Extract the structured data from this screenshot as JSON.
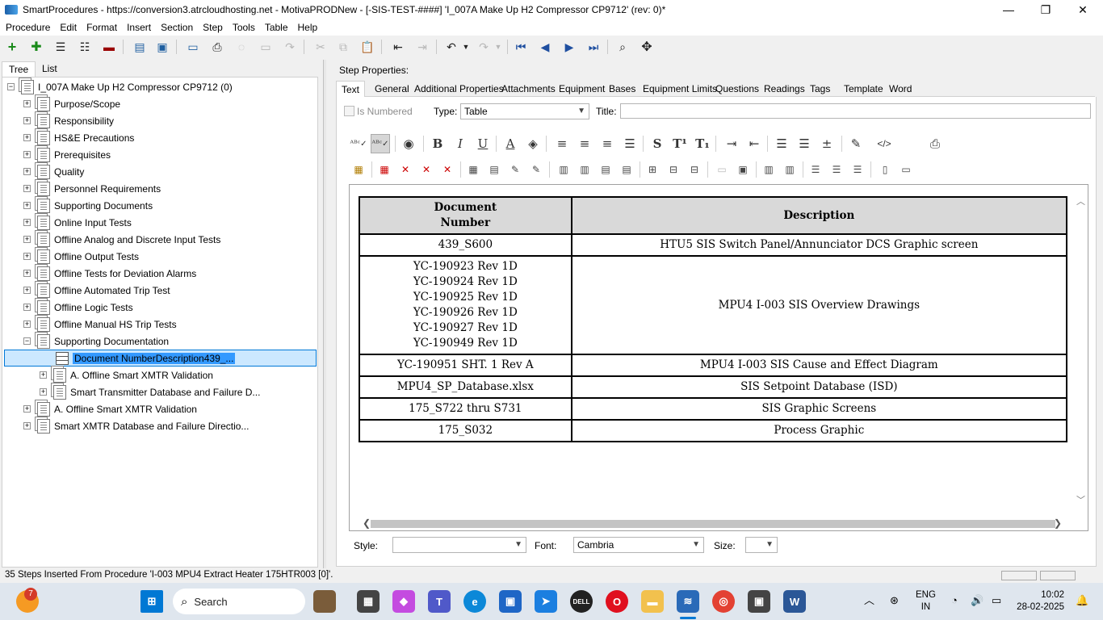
{
  "window": {
    "title": "SmartProcedures - https://conversion3.atrcloudhosting.net - MotivaPRODNew - [-SIS-TEST-####] 'I_007A Make Up H2 Compressor CP9712' (rev: 0)*",
    "minimize": "—",
    "restore": "❐",
    "close": "✕"
  },
  "menu": [
    "Procedure",
    "Edit",
    "Format",
    "Insert",
    "Section",
    "Step",
    "Tools",
    "Table",
    "Help"
  ],
  "left_tabs": [
    "Tree",
    "List"
  ],
  "tree": {
    "root": "I_007A Make Up H2 Compressor CP9712 (0)",
    "items": [
      "Purpose/Scope",
      "Responsibility",
      "HS&E Precautions",
      "Prerequisites",
      "Quality",
      "Personnel Requirements",
      "Supporting Documents",
      "Online Input Tests",
      "Offline Analog and Discrete Input Tests",
      "Offline Output Tests",
      "Offline Tests for Deviation Alarms",
      "Offline Automated Trip Test",
      "Offline Logic Tests",
      "Offline Manual HS Trip Tests",
      "Supporting Documentation"
    ],
    "children": [
      "Document NumberDescription439_...",
      "A. Offline Smart XMTR Validation",
      "Smart Transmitter Database and Failure D..."
    ],
    "after": [
      "A. Offline Smart XMTR Validation",
      "Smart XMTR Database and Failure Directio..."
    ]
  },
  "step_properties": {
    "label": "Step Properties:",
    "tabs": [
      "Text",
      "General",
      "Additional Properties",
      "Attachments",
      "Equipment",
      "Bases",
      "Equipment Limits",
      "Questions",
      "Readings",
      "Tags",
      "Template",
      "Word"
    ],
    "is_numbered": "Is Numbered",
    "type_label": "Type:",
    "type_value": "Table",
    "title_label": "Title:",
    "title_value": ""
  },
  "format_toolbar": {
    "bold": "B",
    "italic": "I",
    "underline": "U",
    "strike": "S",
    "superscript": "T¹",
    "subscript": "T₁",
    "html": "</>"
  },
  "document_table": {
    "headers": [
      "Document\nNumber",
      "Description"
    ],
    "rows": [
      {
        "number": "439_S600",
        "description": "HTU5 SIS Switch Panel/Annunciator DCS Graphic screen"
      },
      {
        "number": "YC-190923 Rev 1D\nYC-190924 Rev 1D\nYC-190925 Rev 1D\nYC-190926 Rev 1D\nYC-190927 Rev 1D\nYC-190949 Rev 1D",
        "description": "MPU4 I-003 SIS Overview Drawings"
      },
      {
        "number": "YC-190951 SHT. 1 Rev A",
        "description": "MPU4 I-003 SIS Cause and Effect Diagram"
      },
      {
        "number": "MPU4_SP_Database.xlsx",
        "description": "SIS Setpoint Database (ISD)"
      },
      {
        "number": "175_S722 thru S731",
        "description": "SIS Graphic Screens"
      },
      {
        "number": "175_S032",
        "description": "Process Graphic"
      }
    ]
  },
  "bottom_bar": {
    "style_label": "Style:",
    "style_value": "",
    "font_label": "Font:",
    "font_value": "Cambria",
    "size_label": "Size:",
    "size_value": ""
  },
  "status": {
    "message": "35 Steps Inserted From Procedure 'I-003 MPU4 Extract Heater 175HTR003 [0]'."
  },
  "taskbar": {
    "weather_badge": "7",
    "search": "Search",
    "lang": "ENG",
    "region": "IN",
    "time": "10:02",
    "date": "28-02-2025"
  },
  "colors": {
    "selection": "#3399ff",
    "accent": "#0078d7",
    "table_header": "#d9d9d9"
  }
}
